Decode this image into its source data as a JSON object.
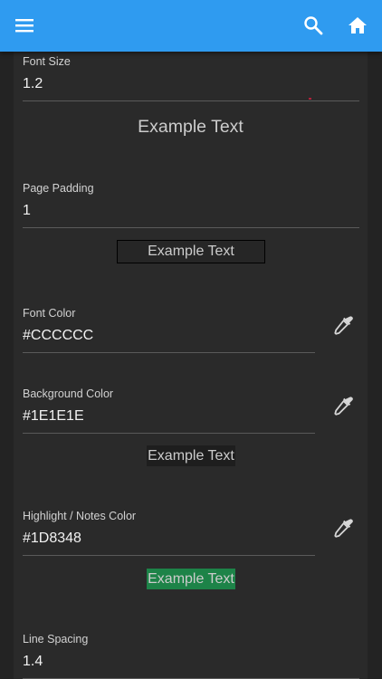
{
  "colors": {
    "appbar": "#2f9bf0",
    "font_color": "#CCCCCC",
    "background_color": "#1E1E1E",
    "highlight_color": "#1D8348"
  },
  "appbar": {
    "menu_icon": "hamburger-menu-icon",
    "search_icon": "search-icon",
    "home_icon": "home-icon"
  },
  "settings": {
    "font_size": {
      "label": "Font Size",
      "value": "1.2"
    },
    "font_size_example": "Example Text",
    "page_padding": {
      "label": "Page Padding",
      "value": "1"
    },
    "page_padding_example": "Example Text",
    "font_color": {
      "label": "Font Color",
      "value": "#CCCCCC",
      "picker_icon": "eyedropper-icon"
    },
    "background_color": {
      "label": "Background Color",
      "value": "#1E1E1E",
      "picker_icon": "eyedropper-icon"
    },
    "background_color_example": "Example Text",
    "highlight_color": {
      "label": "Highlight / Notes Color",
      "value": "#1D8348",
      "picker_icon": "eyedropper-icon"
    },
    "highlight_color_example": "Example Text",
    "line_spacing": {
      "label": "Line Spacing",
      "value": "1.4"
    }
  }
}
